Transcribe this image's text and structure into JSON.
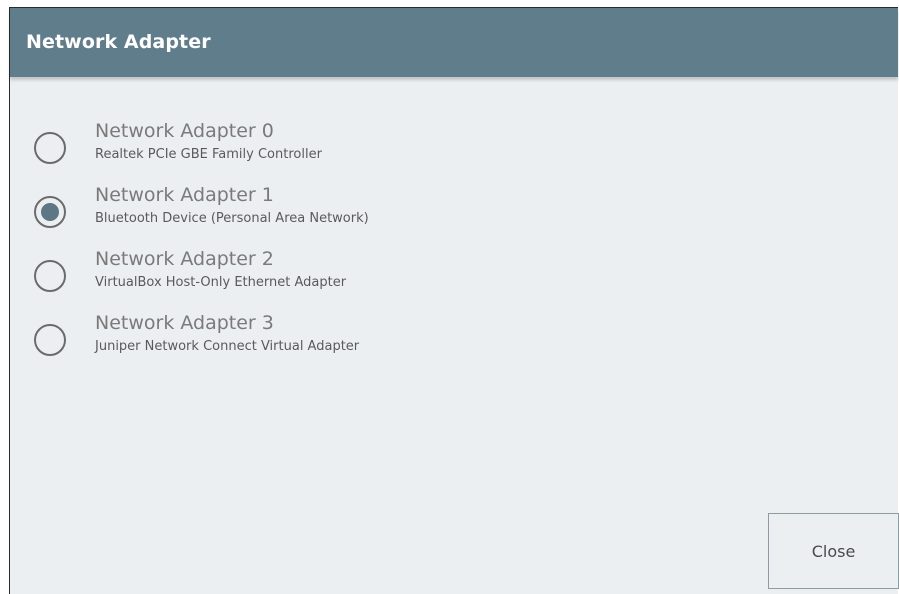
{
  "dialog": {
    "title": "Network Adapter"
  },
  "adapters": [
    {
      "name": "Network Adapter 0",
      "description": "Realtek PCIe GBE Family Controller",
      "selected": false
    },
    {
      "name": "Network Adapter 1",
      "description": "Bluetooth Device (Personal Area Network)",
      "selected": true
    },
    {
      "name": "Network Adapter 2",
      "description": "VirtualBox Host-Only Ethernet Adapter",
      "selected": false
    },
    {
      "name": "Network Adapter 3",
      "description": "Juniper Network Connect Virtual Adapter",
      "selected": false
    }
  ],
  "footer": {
    "close_label": "Close"
  },
  "colors": {
    "titlebar": "#607d8b",
    "background": "#eceff1",
    "radio_selected": "#5d7785"
  },
  "icons": {
    "radio_unchecked": "radio-unchecked-icon",
    "radio_checked": "radio-checked-icon"
  }
}
